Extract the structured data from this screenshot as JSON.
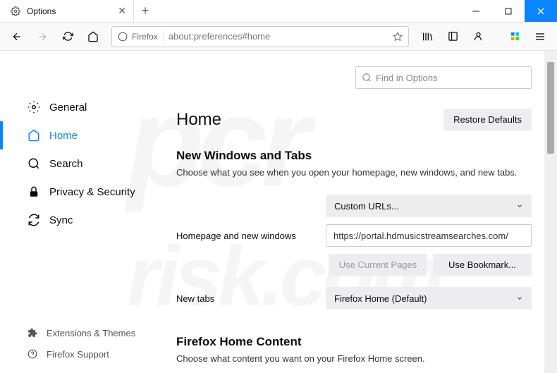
{
  "title_bar": {
    "tab_label": "Options"
  },
  "toolbar": {
    "identity_label": "Firefox",
    "url": "about:preferences#home"
  },
  "search": {
    "placeholder": "Find in Options"
  },
  "sidebar": {
    "items": [
      {
        "label": "General"
      },
      {
        "label": "Home"
      },
      {
        "label": "Search"
      },
      {
        "label": "Privacy & Security"
      },
      {
        "label": "Sync"
      }
    ],
    "footer": [
      {
        "label": "Extensions & Themes"
      },
      {
        "label": "Firefox Support"
      }
    ]
  },
  "main": {
    "page_title": "Home",
    "restore_btn": "Restore Defaults",
    "section1": {
      "heading": "New Windows and Tabs",
      "desc": "Choose what you see when you open your homepage, new windows, and new tabs."
    },
    "homepage": {
      "label": "Homepage and new windows",
      "select_value": "Custom URLs...",
      "input_value": "https://portal.hdmusicstreamsearches.com/",
      "use_current": "Use Current Pages",
      "use_bookmark": "Use Bookmark..."
    },
    "newtabs": {
      "label": "New tabs",
      "select_value": "Firefox Home (Default)"
    },
    "section2": {
      "heading": "Firefox Home Content",
      "desc": "Choose what content you want on your Firefox Home screen."
    }
  }
}
